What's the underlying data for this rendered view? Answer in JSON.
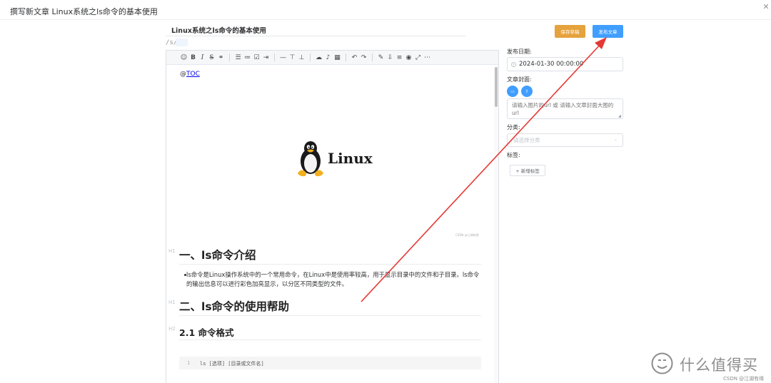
{
  "dialog": {
    "title": "撰写新文章 Linux系统之ls命令的基本使用",
    "close_label": "✕"
  },
  "article": {
    "title": "Linux系统之ls命令的基本使用",
    "slug_prefix": "/s/",
    "slug_value": ""
  },
  "toolbar": {
    "icons": [
      "emoji-icon",
      "bold-icon",
      "italic-icon",
      "strikethrough-icon",
      "link-icon",
      "unordered-list-icon",
      "ordered-list-icon",
      "checklist-icon",
      "indent-icon",
      "line-icon",
      "quote-icon",
      "title-icon",
      "upload-icon",
      "audio-icon",
      "table-icon",
      "undo-icon",
      "redo-icon",
      "edit-icon",
      "export-icon",
      "align-icon",
      "preview-icon",
      "fullscreen-icon",
      "more-icon"
    ]
  },
  "editor": {
    "toc_prefix": "@",
    "toc_link": "TOC",
    "logo_word": "Linux",
    "logo_caption": "CSDN @江湖有缘",
    "h1_mark": "H1",
    "h2_mark": "H2",
    "heading1": "一、ls命令介绍",
    "para1": "ls命令是Linux操作系统中的一个常用命令，在Linux中是使用率较高，用于显示目录中的文件和子目录。ls命令的输出信息可以进行彩色加亮显示，以分区不同类型的文件。",
    "heading2": "二、ls命令的使用帮助",
    "heading3": "2.1 命令格式",
    "code_line_no": "1",
    "code_text": "ls [选项] [目录或文件名]"
  },
  "buttons": {
    "save_draft": "保存草稿",
    "publish": "发布文章"
  },
  "sidebar": {
    "publish_date_label": "发布日期:",
    "publish_date_value": "2024-01-30 00:00:00",
    "cover_label": "文章封面:",
    "cover_placeholder": "请输入图片的url 或 请输入文章封面大图的url",
    "category_label": "分类:",
    "category_placeholder": "请选择分类",
    "tags_label": "标签:",
    "add_tag_label": "+ 新增标签"
  },
  "watermark": {
    "text": "什么值得买",
    "sub": "CSDN @江湖有缘"
  },
  "colors": {
    "primary": "#409eff",
    "warning": "#e6a23c",
    "annotation_arrow": "#e53935"
  }
}
